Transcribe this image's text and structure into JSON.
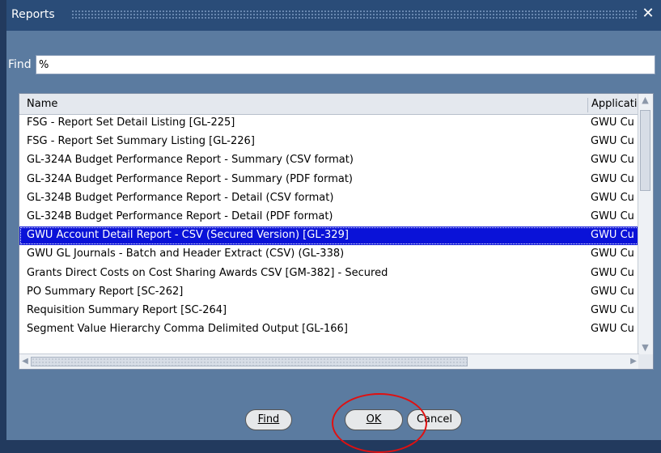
{
  "window": {
    "title": "Reports",
    "close_glyph": "✕"
  },
  "find": {
    "label": "Find",
    "value": "%"
  },
  "list": {
    "columns": [
      "Name",
      "Applicati"
    ],
    "rows": [
      {
        "name": "FSG - Report Set Detail Listing [GL-225]",
        "app": "GWU Cu"
      },
      {
        "name": "FSG - Report Set Summary Listing [GL-226]",
        "app": "GWU Cu"
      },
      {
        "name": "GL-324A Budget Performance Report - Summary (CSV format)",
        "app": "GWU Cu"
      },
      {
        "name": "GL-324A Budget Performance Report - Summary (PDF format)",
        "app": "GWU Cu"
      },
      {
        "name": "GL-324B Budget Performance Report - Detail (CSV format)",
        "app": "GWU Cu"
      },
      {
        "name": "GL-324B Budget Performance Report - Detail (PDF format)",
        "app": "GWU Cu"
      },
      {
        "name": "GWU Account Detail Report - CSV (Secured Version) [GL-329]",
        "app": "GWU Cu"
      },
      {
        "name": "GWU GL Journals - Batch and Header Extract (CSV) (GL-338)",
        "app": "GWU Cu"
      },
      {
        "name": "Grants Direct Costs on Cost Sharing Awards CSV [GM-382] - Secured",
        "app": "GWU Cu"
      },
      {
        "name": "PO Summary Report [SC-262]",
        "app": "GWU Cu"
      },
      {
        "name": "Requisition Summary Report [SC-264]",
        "app": "GWU Cu"
      },
      {
        "name": "Segment Value Hierarchy Comma Delimited Output [GL-166]",
        "app": "GWU Cu"
      }
    ],
    "selected_index": 6
  },
  "buttons": {
    "find": "Find",
    "ok": "OK",
    "cancel": "Cancel"
  },
  "colors": {
    "titlebar": "#2a4c78",
    "body": "#5b7ba0",
    "selection": "#0a12d8",
    "annotation": "#e01010"
  }
}
